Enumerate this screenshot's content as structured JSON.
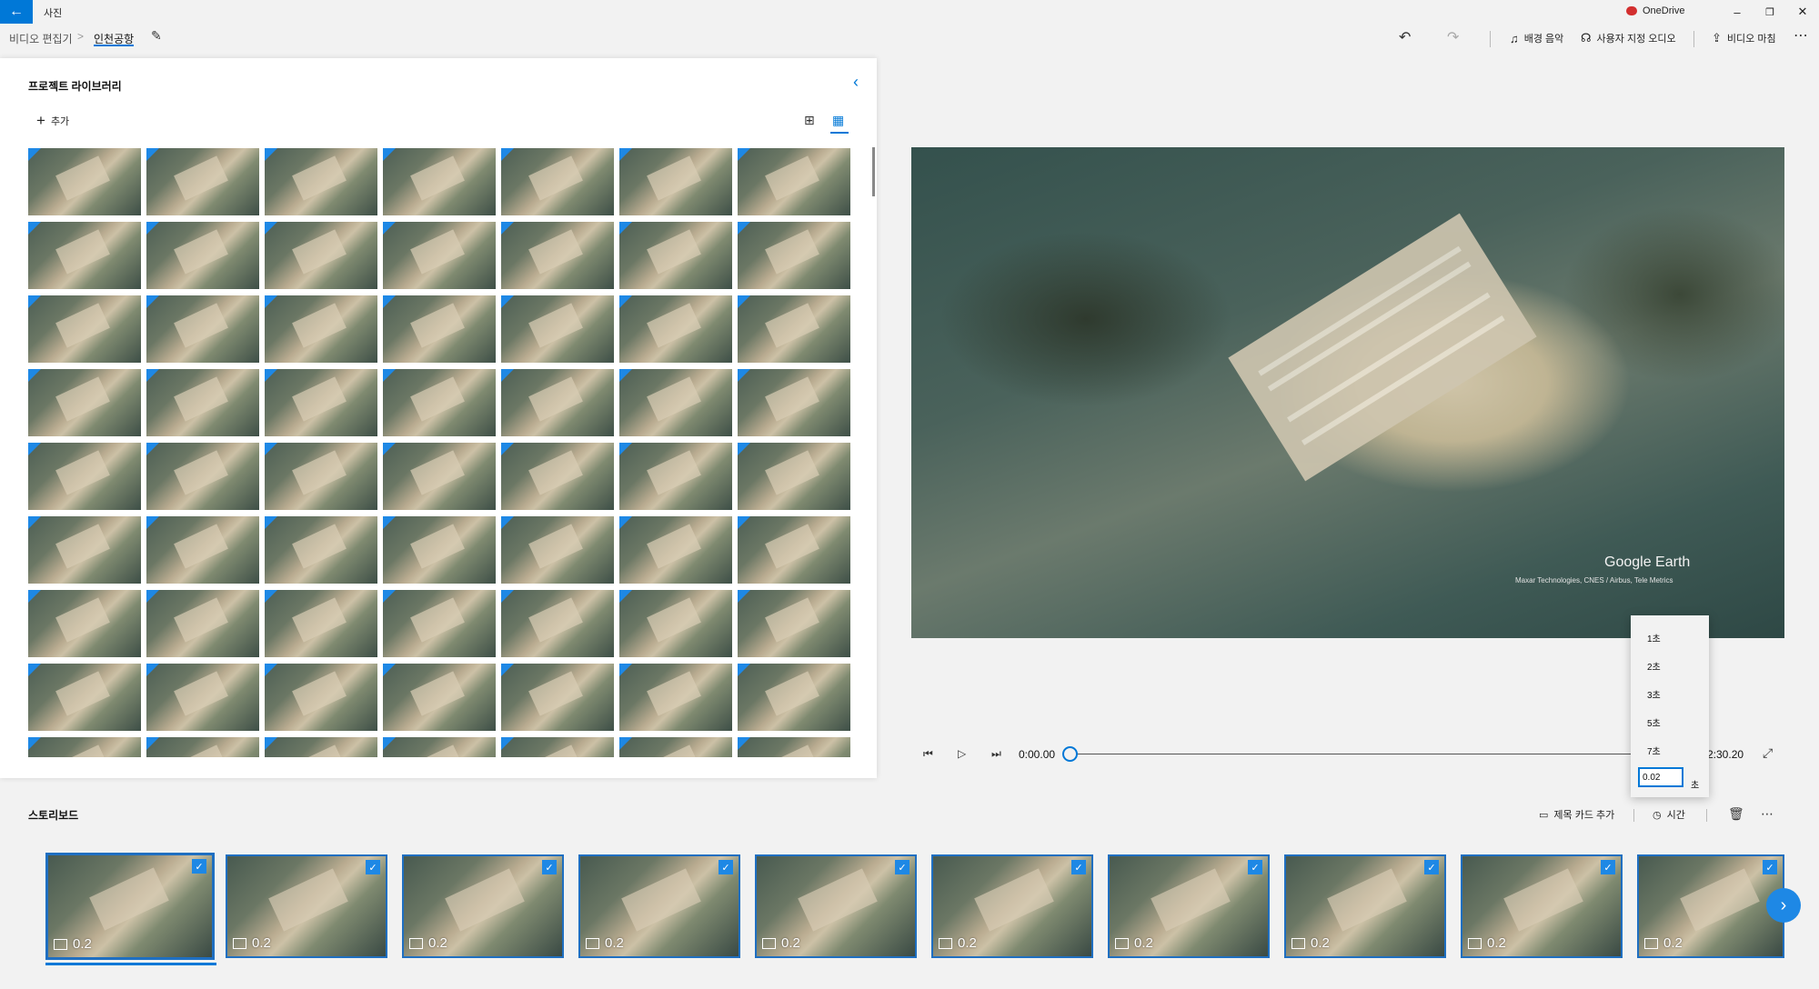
{
  "titlebar": {
    "app_title": "사진",
    "onedrive_label": "OneDrive",
    "minimize": "–",
    "restore": "❐",
    "close": "✕",
    "back": "←"
  },
  "breadcrumb": {
    "root": "비디오 편집기",
    "separator": ">",
    "current": "인천공항"
  },
  "toolbar": {
    "undo": "↶",
    "redo": "↷",
    "background_music": "배경 음악",
    "custom_audio": "사용자 지정 오디오",
    "finish_video": "비디오 마침",
    "more": "⋯"
  },
  "library": {
    "title": "프로젝트 라이브러리",
    "add_label": "추가",
    "collapse_glyph": "‹",
    "view_small_glyph": "⊞",
    "view_large_glyph": "▦"
  },
  "preview": {
    "brand": "Google Earth",
    "credit": "Maxar Technologies, CNES / Airbus, Tele Metrics"
  },
  "playback": {
    "start_time": "0:00.00",
    "end_time": "2:30.20"
  },
  "duration_menu": {
    "options": [
      "1초",
      "2초",
      "3초",
      "5초",
      "7초"
    ],
    "input_value": "0.02",
    "unit": "초"
  },
  "storyboard": {
    "title": "스토리보드",
    "add_title_card": "제목 카드 추가",
    "duration": "시간",
    "clip_duration": "0.2"
  }
}
